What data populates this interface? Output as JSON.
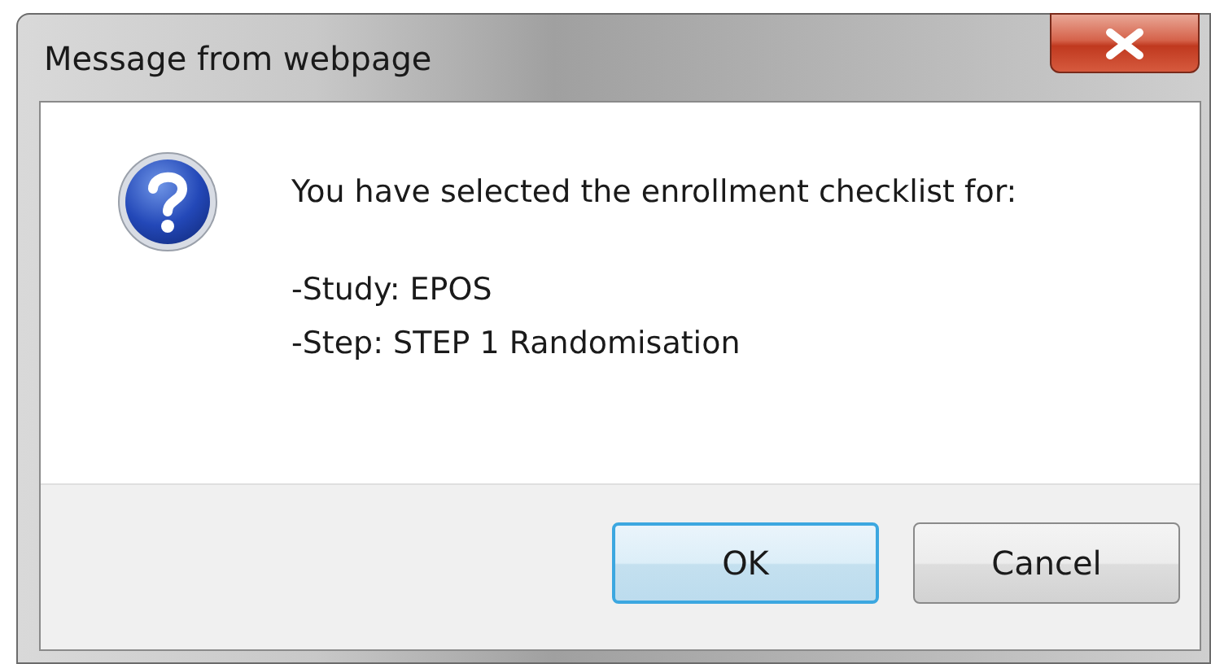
{
  "window": {
    "title": "Message from webpage"
  },
  "message": {
    "lines": [
      "You have selected the enrollment checklist for:",
      "-Study: EPOS",
      "-Step: STEP 1 Randomisation"
    ]
  },
  "buttons": [
    {
      "label": "OK",
      "focused": true
    },
    {
      "label": "Cancel",
      "focused": false
    }
  ]
}
